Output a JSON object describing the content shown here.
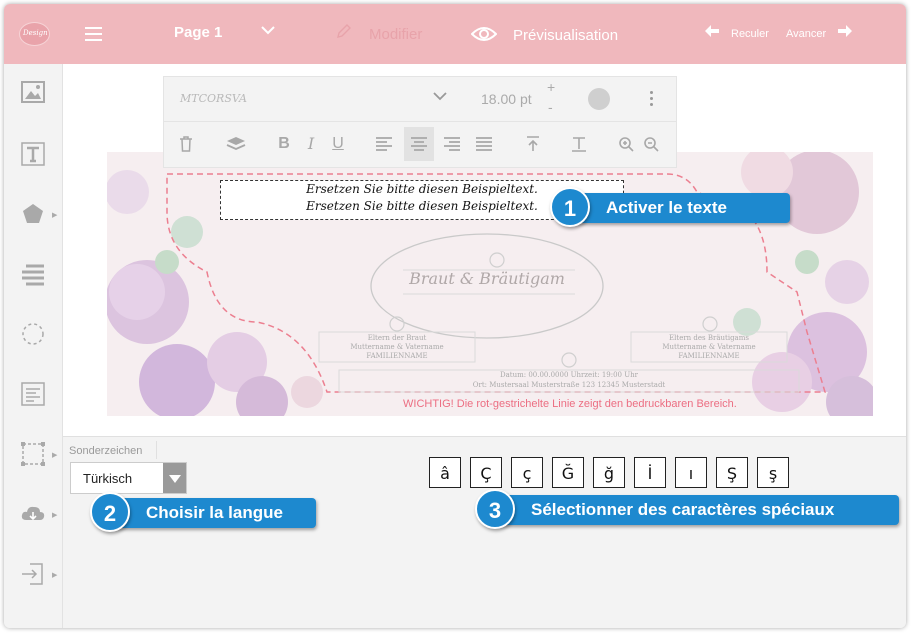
{
  "topbar": {
    "logo_text": "Design",
    "page_label": "Page 1",
    "modify_label": "Modifier",
    "preview_label": "Prévisualisation",
    "undo_label": "Reculer",
    "redo_label": "Avancer",
    "colors": {
      "topbar": "#f0b8bd",
      "accent": "#1d89cf"
    }
  },
  "sidebar": {
    "items": [
      "image-icon",
      "text-icon",
      "shape-icon",
      "lines-icon",
      "circle-dashed-icon",
      "align-box-icon",
      "select-frame-icon",
      "cloud-download-icon",
      "exit-icon"
    ]
  },
  "toolbar": {
    "font_name": "MTCORSVA",
    "font_size": "18.00",
    "font_unit": "pt",
    "plus": "+",
    "minus": "-"
  },
  "design": {
    "line1": "Ersetzen Sie bitte diesen Beispieltext.",
    "line2": "Ersetzen Sie bitte diesen Beispieltext.",
    "center_title": "Braut & Bräutigam",
    "left_block": [
      "Eltern der Braut",
      "Muttername & Vatername",
      "FAMILIENNAME"
    ],
    "right_block": [
      "Eltern des Bräutigams",
      "Muttername & Vatername",
      "FAMILIENNAME"
    ],
    "date_line": "Datum: 00.00.0000  Uhrzeit: 19:00 Uhr",
    "place_line": "Ort: Mustersaal  Musterstraße 123  12345 Musterstadt",
    "warning": "WICHTIG!  Die rot-gestrichelte Linie zeigt den bedruckbaren Bereich."
  },
  "special_chars": {
    "label": "Sonderzeichen",
    "language": "Türkisch",
    "chars": [
      "â",
      "Ç",
      "ç",
      "Ğ",
      "ğ",
      "İ",
      "ı",
      "Ş",
      "ş"
    ]
  },
  "callouts": [
    {
      "num": "1",
      "text": "Activer le texte"
    },
    {
      "num": "2",
      "text": "Choisir la langue"
    },
    {
      "num": "3",
      "text": "Sélectionner des caractères spéciaux"
    }
  ]
}
